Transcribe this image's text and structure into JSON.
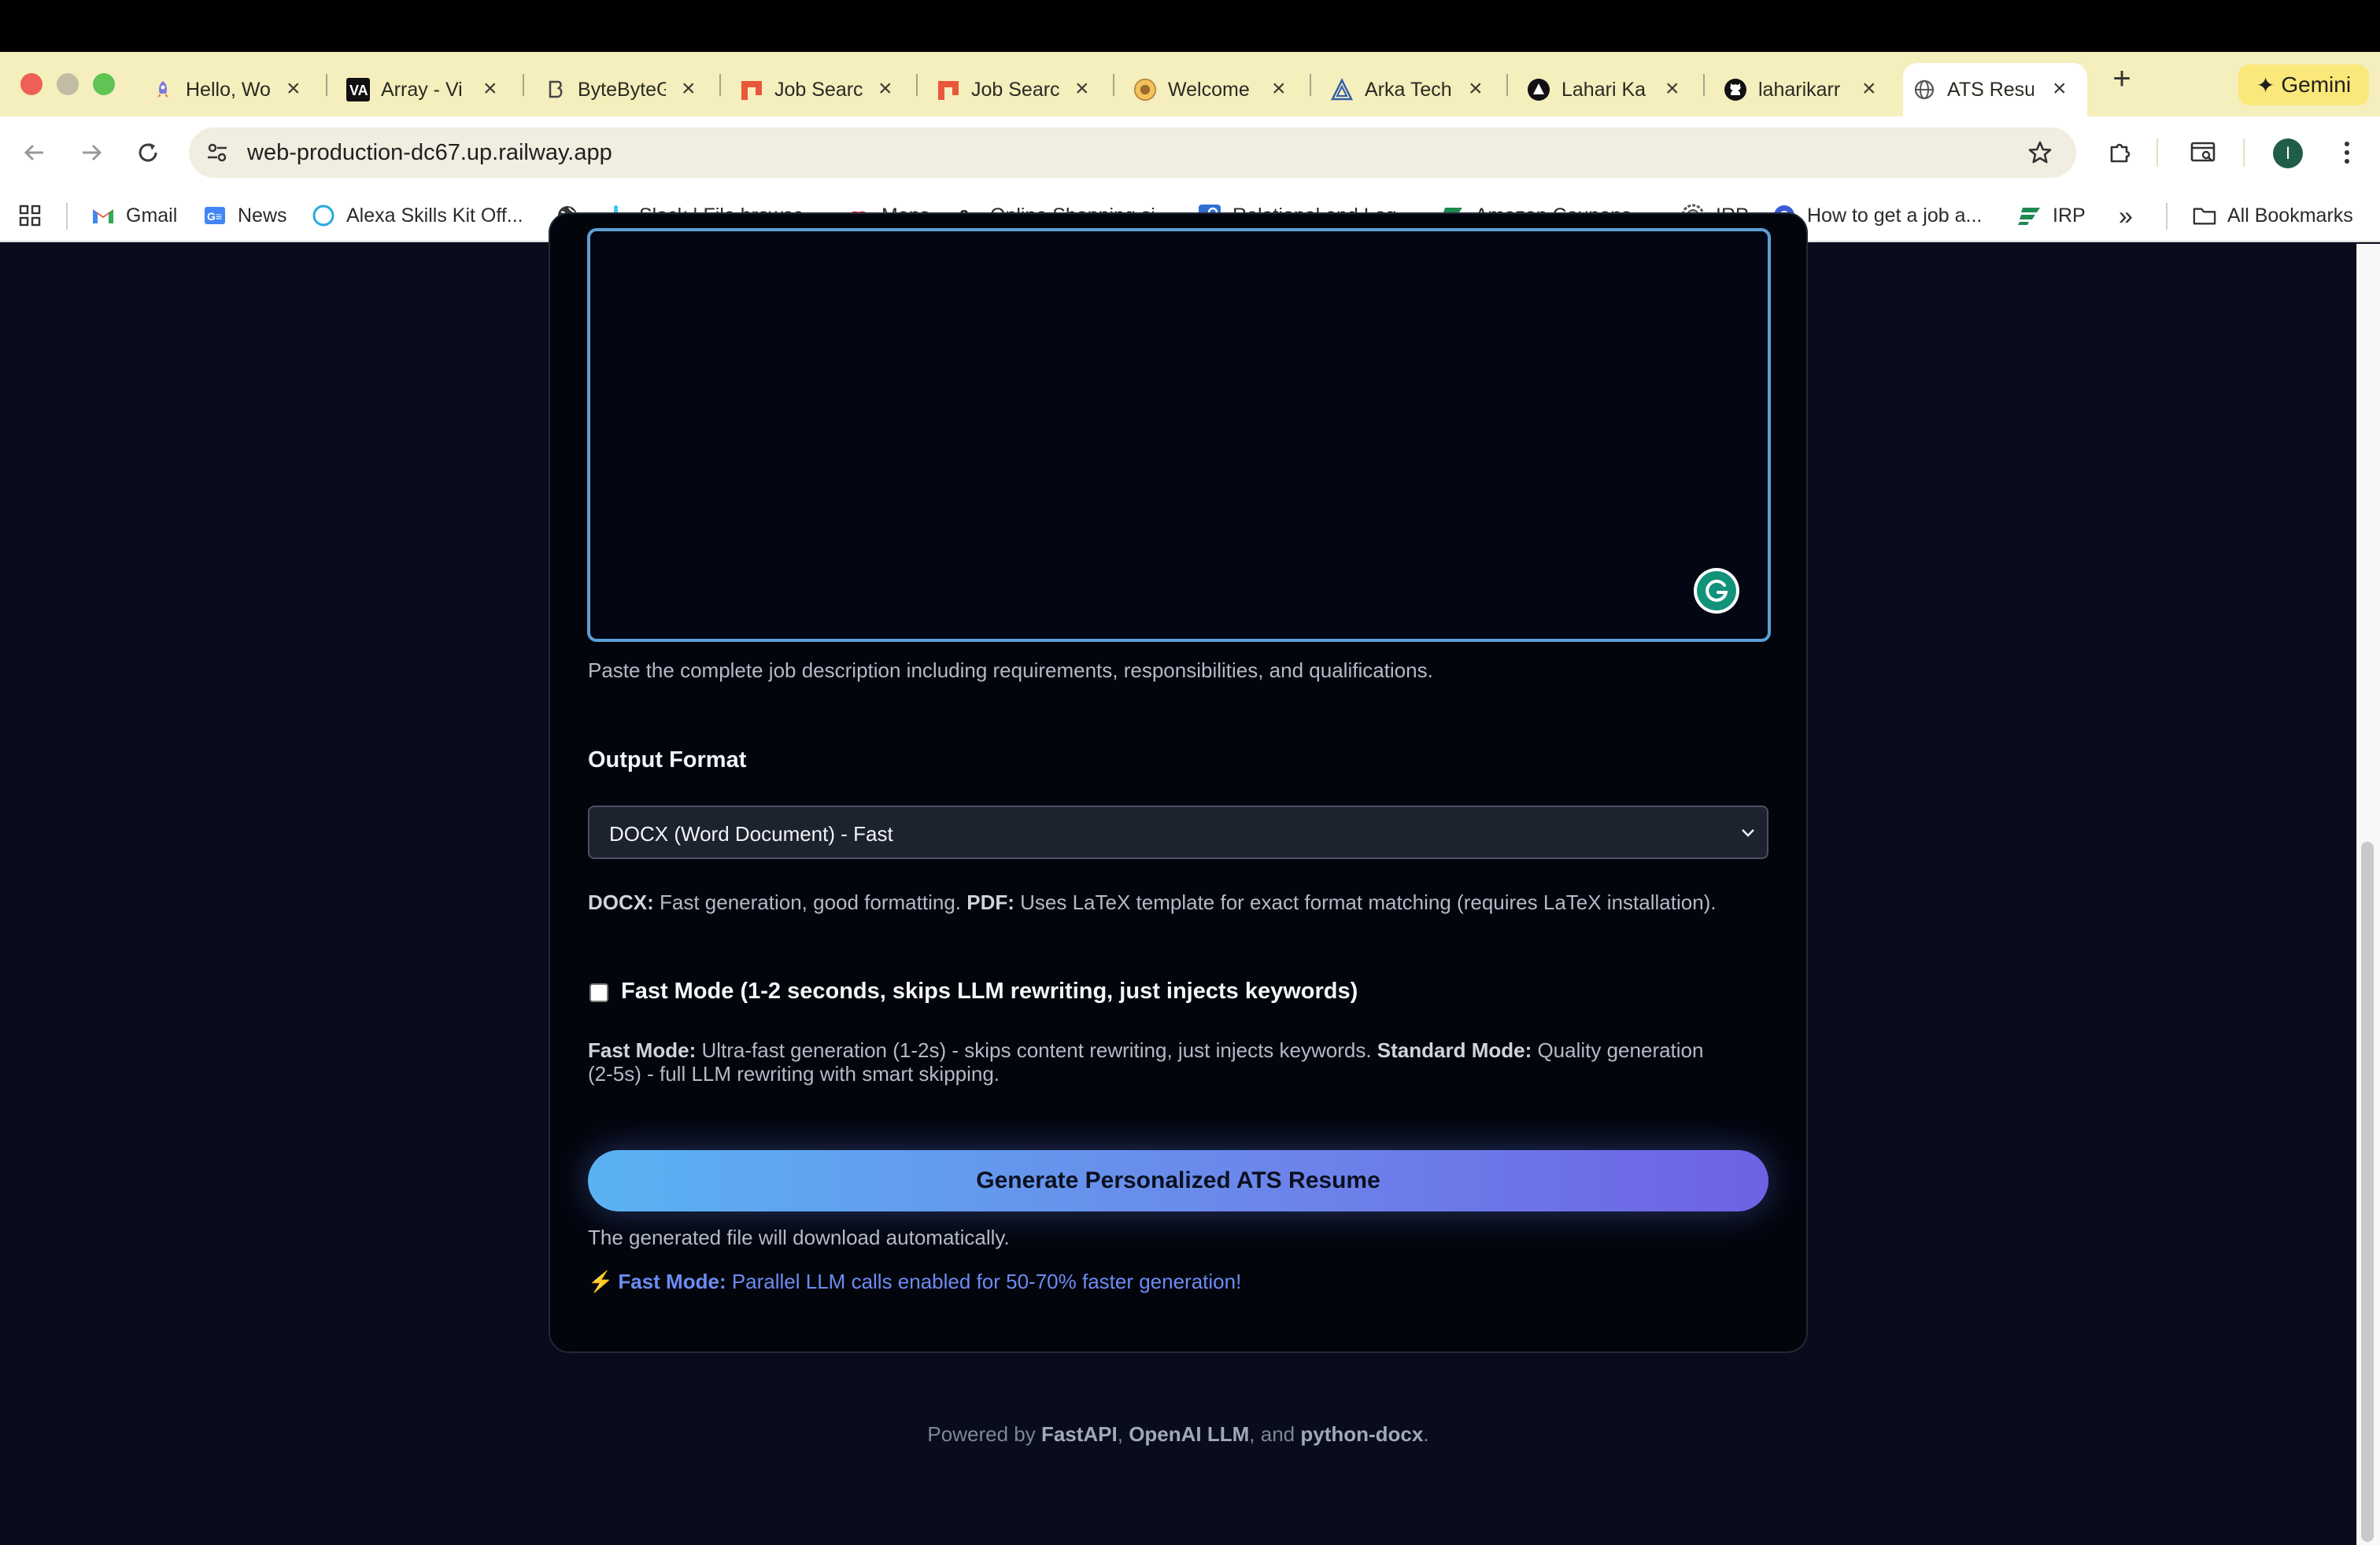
{
  "browser": {
    "tabs": [
      {
        "title": "Hello, Wo",
        "icon": "rocket-icon"
      },
      {
        "title": "Array - Vi",
        "icon": "va-logo-icon"
      },
      {
        "title": "ByteByteG",
        "icon": "bytebytego-icon"
      },
      {
        "title": "Job Searc",
        "icon": "job-search-icon"
      },
      {
        "title": "Job Searc",
        "icon": "job-search-icon"
      },
      {
        "title": "Welcome",
        "icon": "sunflower-icon"
      },
      {
        "title": "Arka Tech",
        "icon": "arka-icon"
      },
      {
        "title": "Lahari Ka",
        "icon": "triangle-logo-icon"
      },
      {
        "title": "laharikarr",
        "icon": "github-icon"
      },
      {
        "title": "ATS Resu",
        "icon": "globe-icon",
        "active": true
      }
    ],
    "new_tab": "+",
    "gemini_label": "Gemini",
    "url": "web-production-dc67.up.railway.app",
    "profile_initial": "I",
    "bookmarks": [
      {
        "label": "Gmail",
        "icon": "gmail-icon"
      },
      {
        "label": "News",
        "icon": "news-icon"
      },
      {
        "label": "Alexa Skills Kit Off...",
        "icon": "alexa-icon"
      },
      {
        "label": "",
        "icon": "globe-icon"
      },
      {
        "label": "Slack | File browse...",
        "icon": "slack-icon"
      },
      {
        "label": "Maps",
        "icon": "lips-icon"
      },
      {
        "label": "Online Shopping si...",
        "icon": "amazon-icon"
      },
      {
        "label": "Relational and Log...",
        "icon": "key-icon"
      },
      {
        "label": "Amazon Coupons...",
        "icon": "green-flag-icon"
      },
      {
        "label": "IRP",
        "icon": "gear-badge-icon"
      },
      {
        "label": "How to get a job a...",
        "icon": "blue-badge-icon"
      },
      {
        "label": "IRP",
        "icon": "green-flag-icon"
      }
    ],
    "overflow": "»",
    "all_bookmarks": "All Bookmarks"
  },
  "form": {
    "jd_hint": "Paste the complete job description including requirements, responsibilities, and qualifications.",
    "format_label": "Output Format",
    "format_value": "DOCX (Word Document) - Fast",
    "format_help": {
      "docx_label": "DOCX:",
      "docx_text": " Fast generation, good formatting. ",
      "pdf_label": "PDF:",
      "pdf_text": " Uses LaTeX template for exact format matching (requires LaTeX installation)."
    },
    "fast_mode_title": "Fast Mode",
    "fast_mode_rest": " (1-2 seconds, skips LLM rewriting, just injects keywords)",
    "mode_help": {
      "fast_label": "Fast Mode:",
      "fast_text": " Ultra-fast generation (1-2s) - skips content rewriting, just injects keywords. ",
      "standard_label": "Standard Mode:",
      "standard_text": " Quality generation",
      "line2": "(2-5s) - full LLM rewriting with smart skipping."
    },
    "generate_button": "Generate Personalized ATS Resume",
    "download_note": "The generated file will download automatically.",
    "fast_note": {
      "bolt": "⚡",
      "label": "Fast Mode:",
      "text": " Parallel LLM calls enabled for 50-70% faster generation!"
    }
  },
  "footer": {
    "prefix": "Powered by ",
    "fastapi": "FastAPI",
    "sep1": ", ",
    "openai": "OpenAI LLM",
    "sep2": ", and ",
    "docx": "python-docx",
    "suffix": "."
  }
}
